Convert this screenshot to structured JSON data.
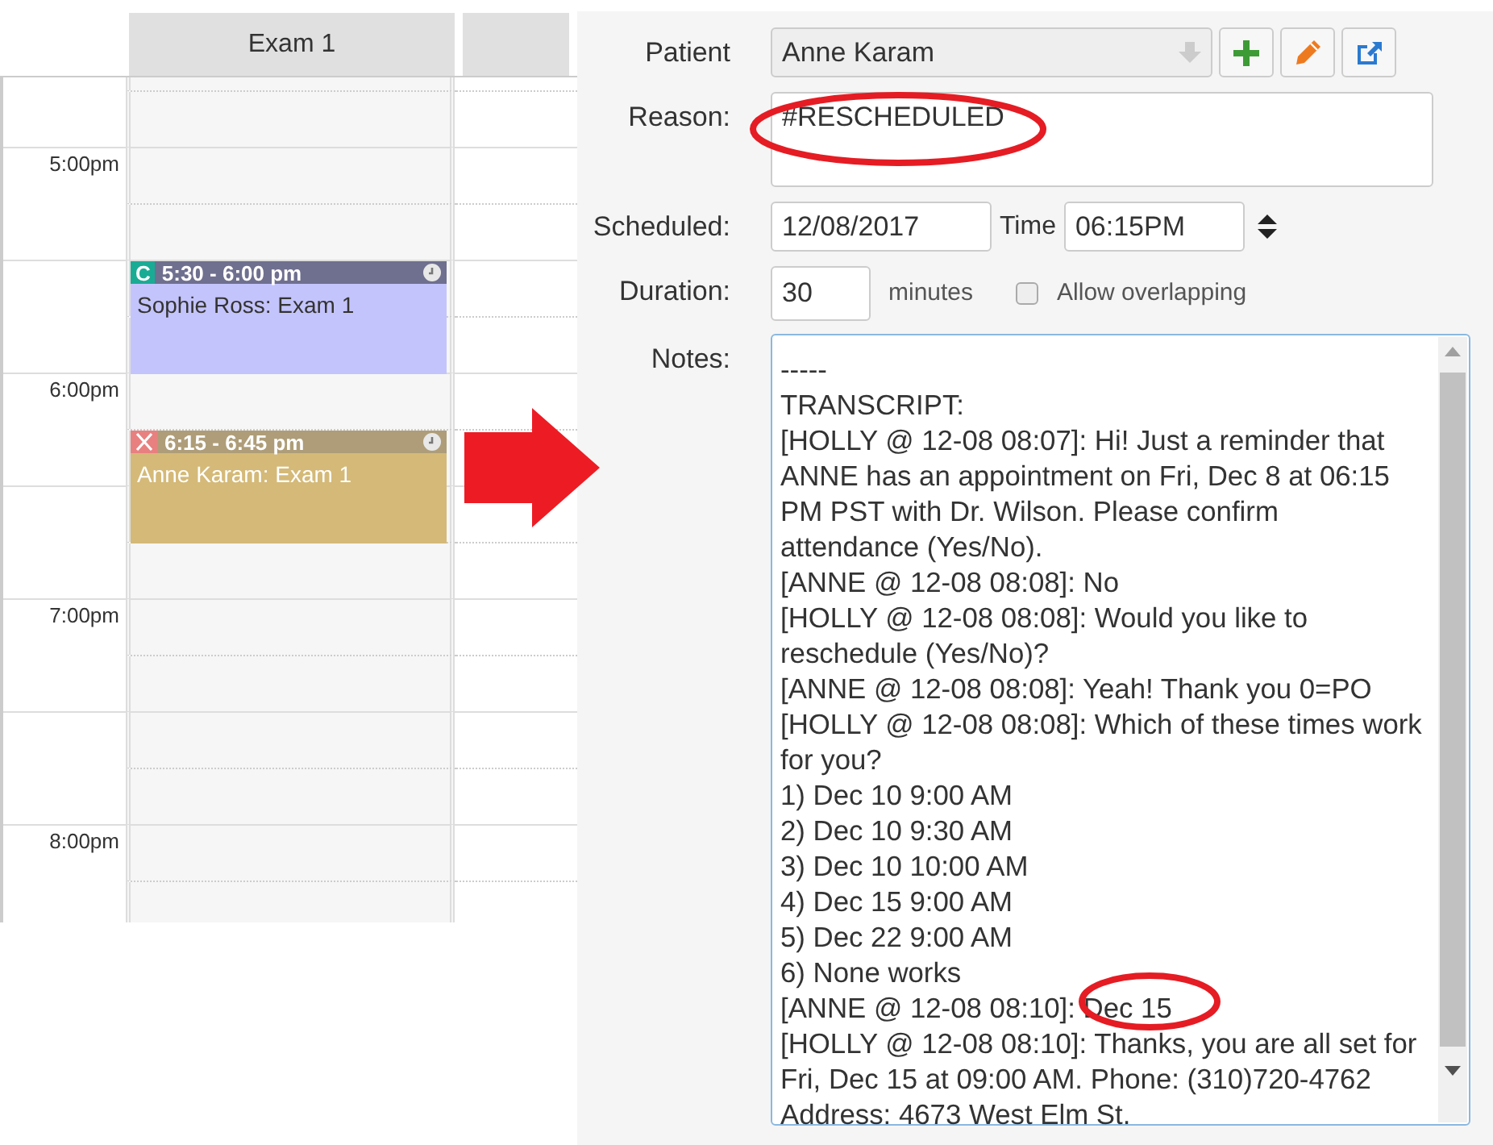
{
  "calendar": {
    "column_header": "Exam 1",
    "slots": [
      {
        "kind": "cut"
      },
      {
        "kind": "quarter"
      },
      {
        "kind": "half",
        "label": "5:00pm"
      },
      {
        "kind": "quarter"
      },
      {
        "kind": "half",
        "event": {
          "kind": "confirmed",
          "badge": "C",
          "time": "5:30 - 6:00 pm",
          "title": "Sophie Ross: Exam 1"
        }
      },
      {
        "kind": "quarter"
      },
      {
        "kind": "half",
        "label": "6:00pm"
      },
      {
        "kind": "quarter",
        "event": {
          "kind": "cancelled",
          "time": "6:15 - 6:45 pm",
          "title": "Anne Karam: Exam 1"
        }
      },
      {
        "kind": "half"
      },
      {
        "kind": "quarter"
      },
      {
        "kind": "half",
        "label": "7:00pm"
      },
      {
        "kind": "quarter"
      },
      {
        "kind": "half"
      },
      {
        "kind": "quarter"
      },
      {
        "kind": "half",
        "label": "8:00pm"
      },
      {
        "kind": "quarter"
      }
    ]
  },
  "appointment": {
    "patient": {
      "label": "Patient",
      "value": "Anne Karam"
    },
    "reason": {
      "label": "Reason:",
      "value": "#RESCHEDULED"
    },
    "scheduled": {
      "label": "Scheduled:",
      "date": "12/08/2017",
      "time_label": "Time",
      "time": "06:15PM"
    },
    "duration": {
      "label": "Duration:",
      "value": "30",
      "unit": "minutes",
      "overlap_label": "Allow overlapping",
      "overlap_checked": false
    },
    "notes": {
      "label": "Notes:",
      "lines": [
        "-----",
        "TRANSCRIPT:",
        "[HOLLY @ 12-08 08:07]: Hi! Just a reminder that",
        "ANNE has an appointment on Fri, Dec 8 at 06:15",
        "PM PST with Dr. Wilson. Please confirm",
        "attendance (Yes/No).",
        "[ANNE @ 12-08 08:08]: No",
        "[HOLLY @ 12-08 08:08]: Would you like to",
        "reschedule (Yes/No)?",
        "[ANNE @ 12-08 08:08]: Yeah! Thank you 0=PO",
        "[HOLLY @ 12-08 08:08]: Which of these times work",
        "for you?",
        "1) Dec 10 9:00 AM",
        "2) Dec 10 9:30 AM",
        "3) Dec 10 10:00 AM",
        "4) Dec 15 9:00 AM",
        "5) Dec 22 9:00 AM",
        "6) None works",
        "[ANNE @ 12-08 08:10]: Dec 15",
        "[HOLLY @ 12-08 08:10]: Thanks, you are all set for",
        "Fri, Dec 15 at 09:00 AM. Phone: (310)720-4762",
        "Address: 4673 West Elm St."
      ]
    }
  }
}
